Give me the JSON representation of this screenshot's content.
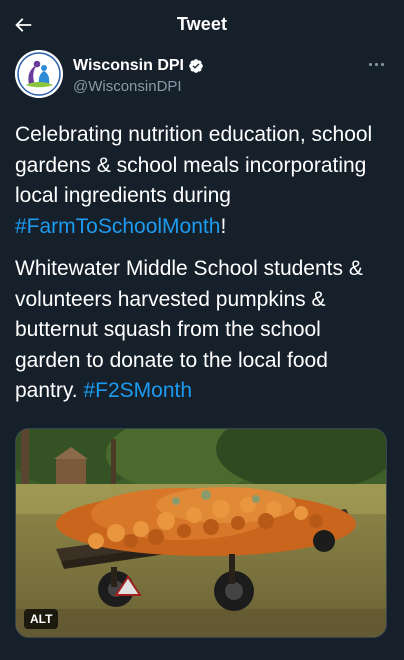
{
  "header": {
    "title": "Tweet",
    "back_icon": "arrow-left-icon"
  },
  "author": {
    "name": "Wisconsin DPI",
    "handle": "@WisconsinDPI",
    "verified": true,
    "more_icon": "more-dots-icon"
  },
  "tweet": {
    "p1_text": "Celebrating nutrition education, school gardens & school meals incorporating local ingredients during ",
    "p1_hashtag": "#FarmToSchoolMonth",
    "p1_end": "!",
    "p2_text": "Whitewater Middle School students & volunteers harvested pumpkins & butternut squash from the school garden to donate to the local food pantry. ",
    "p2_hashtag": "#F2SMonth"
  },
  "media": {
    "alt_label": "ALT"
  },
  "colors": {
    "background": "#15202b",
    "accent": "#1d9bf0",
    "secondary_text": "#8b98a5"
  }
}
